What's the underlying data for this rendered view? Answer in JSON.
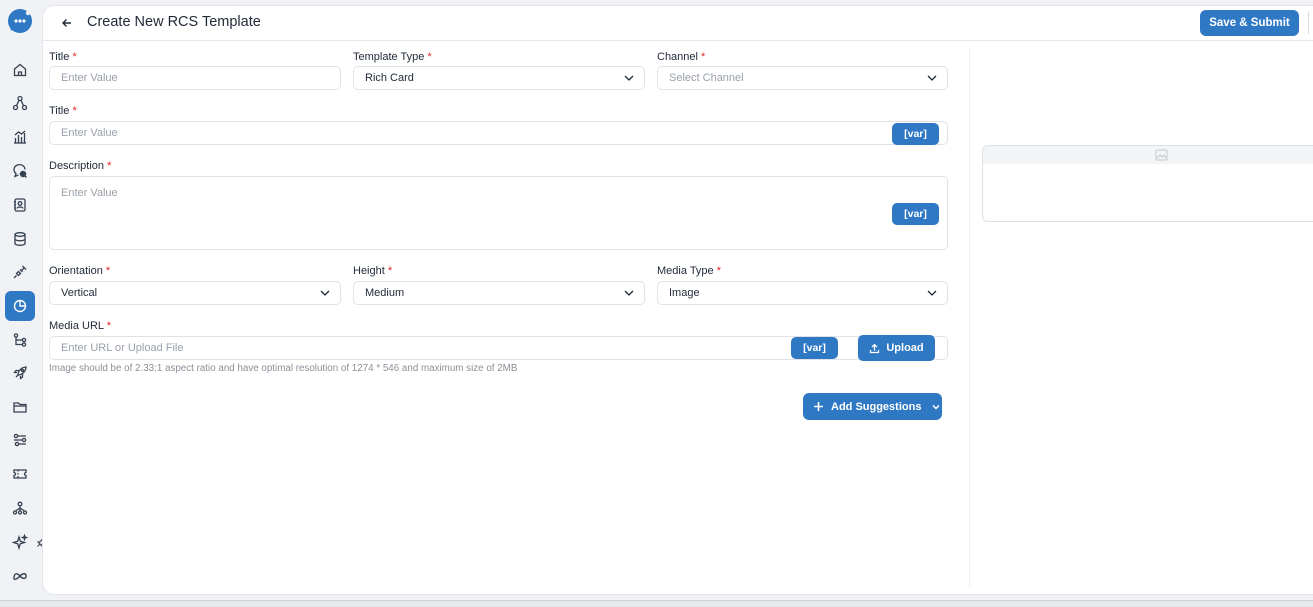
{
  "header": {
    "title": "Create New RCS Template",
    "save_label": "Save & Submit"
  },
  "sidebar": {
    "items": [
      {
        "icon": "home-icon"
      },
      {
        "icon": "network-icon"
      },
      {
        "icon": "analytics-icon"
      },
      {
        "icon": "chat-search-icon"
      },
      {
        "icon": "contacts-icon"
      },
      {
        "icon": "database-icon"
      },
      {
        "icon": "integrations-icon"
      },
      {
        "icon": "reports-icon",
        "active": true
      },
      {
        "icon": "flow-icon"
      },
      {
        "icon": "rocket-icon"
      },
      {
        "icon": "folder-icon"
      },
      {
        "icon": "settings-sliders-icon"
      },
      {
        "icon": "ticket-icon"
      },
      {
        "icon": "hierarchy-icon"
      },
      {
        "icon": "sparkle-icon"
      },
      {
        "icon": "meta-icon"
      }
    ]
  },
  "form": {
    "title": {
      "label": "Title",
      "placeholder": "Enter Value"
    },
    "template_type": {
      "label": "Template Type",
      "value": "Rich Card"
    },
    "channel": {
      "label": "Channel",
      "placeholder": "Select Channel"
    },
    "card_title": {
      "label": "Title",
      "placeholder": "Enter Value",
      "var_label": "[var]"
    },
    "description": {
      "label": "Description",
      "placeholder": "Enter Value",
      "var_label": "[var]"
    },
    "orientation": {
      "label": "Orientation",
      "value": "Vertical"
    },
    "height": {
      "label": "Height",
      "value": "Medium"
    },
    "media_type": {
      "label": "Media Type",
      "value": "Image"
    },
    "media_url": {
      "label": "Media URL",
      "placeholder": "Enter URL or Upload File",
      "var_label": "[var]",
      "upload_label": "Upload",
      "hint": "Image should be of 2.33:1 aspect ratio and have optimal resolution of 1274 * 546 and maximum size of 2MB"
    },
    "add_suggestions_label": "Add Suggestions",
    "required_mark": "*"
  },
  "colors": {
    "accent": "#2f78c4",
    "required": "#e02424"
  }
}
